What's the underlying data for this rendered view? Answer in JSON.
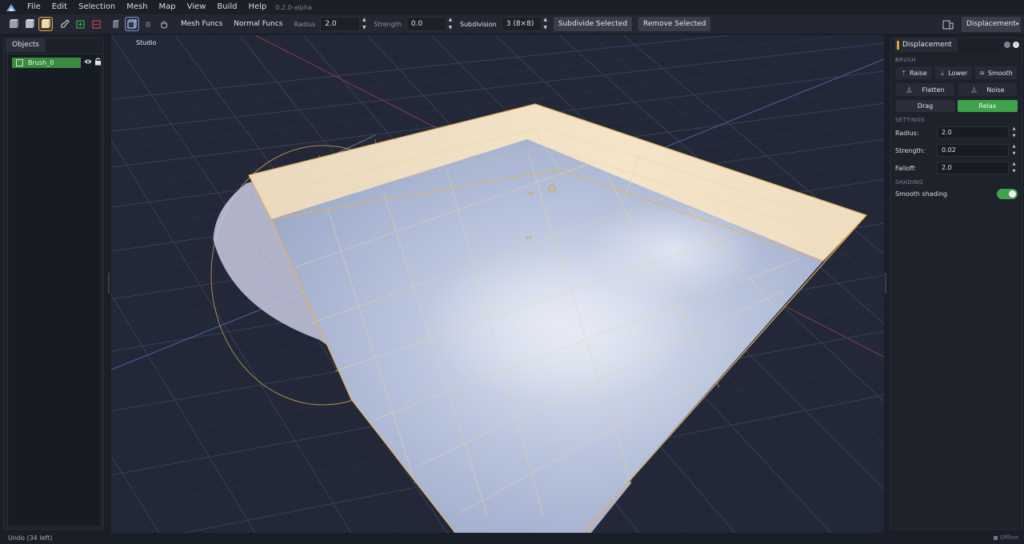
{
  "menu": {
    "items": [
      "File",
      "Edit",
      "Selection",
      "Mesh",
      "Map",
      "View",
      "Build",
      "Help"
    ],
    "version": "0.2.0-alpha"
  },
  "toolbar": {
    "tools": [
      "cube-solid-icon",
      "cube-flat-icon",
      "cube-shaded-icon",
      "paint-icon",
      "add-green-icon",
      "remove-red-icon",
      "wireframe-icon",
      "hand-icon"
    ],
    "mesh_funcs_label": "Mesh Funcs",
    "normal_funcs_label": "Normal Funcs",
    "radius_label": "Radius",
    "radius_value": "2.0",
    "strength_label": "Strength",
    "strength_value": "0.0",
    "subdivision_label": "Subdivision",
    "subdivision_value": "3  (8×8)",
    "subdivide_button": "Subdivide Selected",
    "remove_button": "Remove Selected",
    "mode_value": "Displacement"
  },
  "objects_panel": {
    "tab_label": "Objects",
    "items": [
      {
        "name": "Brush_0",
        "selected": true
      }
    ]
  },
  "viewport": {
    "label": "Studio"
  },
  "displacement_panel": {
    "tab_label": "Displacement",
    "brush_section": "BRUSH",
    "brushes": [
      {
        "label": "Raise",
        "icon": "raise-icon"
      },
      {
        "label": "Lower",
        "icon": "lower-icon"
      },
      {
        "label": "Smooth",
        "icon": "smooth-icon"
      },
      {
        "label": "Flatten",
        "icon": "flatten-icon"
      },
      {
        "label": "Noise",
        "icon": "noise-icon"
      }
    ],
    "modes": [
      {
        "label": "Drag",
        "active": false
      },
      {
        "label": "Relax",
        "active": true
      }
    ],
    "settings_section": "SETTINGS",
    "radius_label": "Radius:",
    "radius_value": "2.0",
    "strength_label": "Strength:",
    "strength_value": "0.02",
    "falloff_label": "Falloff:",
    "falloff_value": "2.0",
    "shading_section": "SHADING",
    "smooth_shading_label": "Smooth shading",
    "smooth_shading_on": true
  },
  "status": {
    "text": "Undo  (34 left)",
    "right": "Offline"
  },
  "colors": {
    "accent": "#e2a23b",
    "active_green": "#3fa34b",
    "viewport_bg": "#222838"
  }
}
